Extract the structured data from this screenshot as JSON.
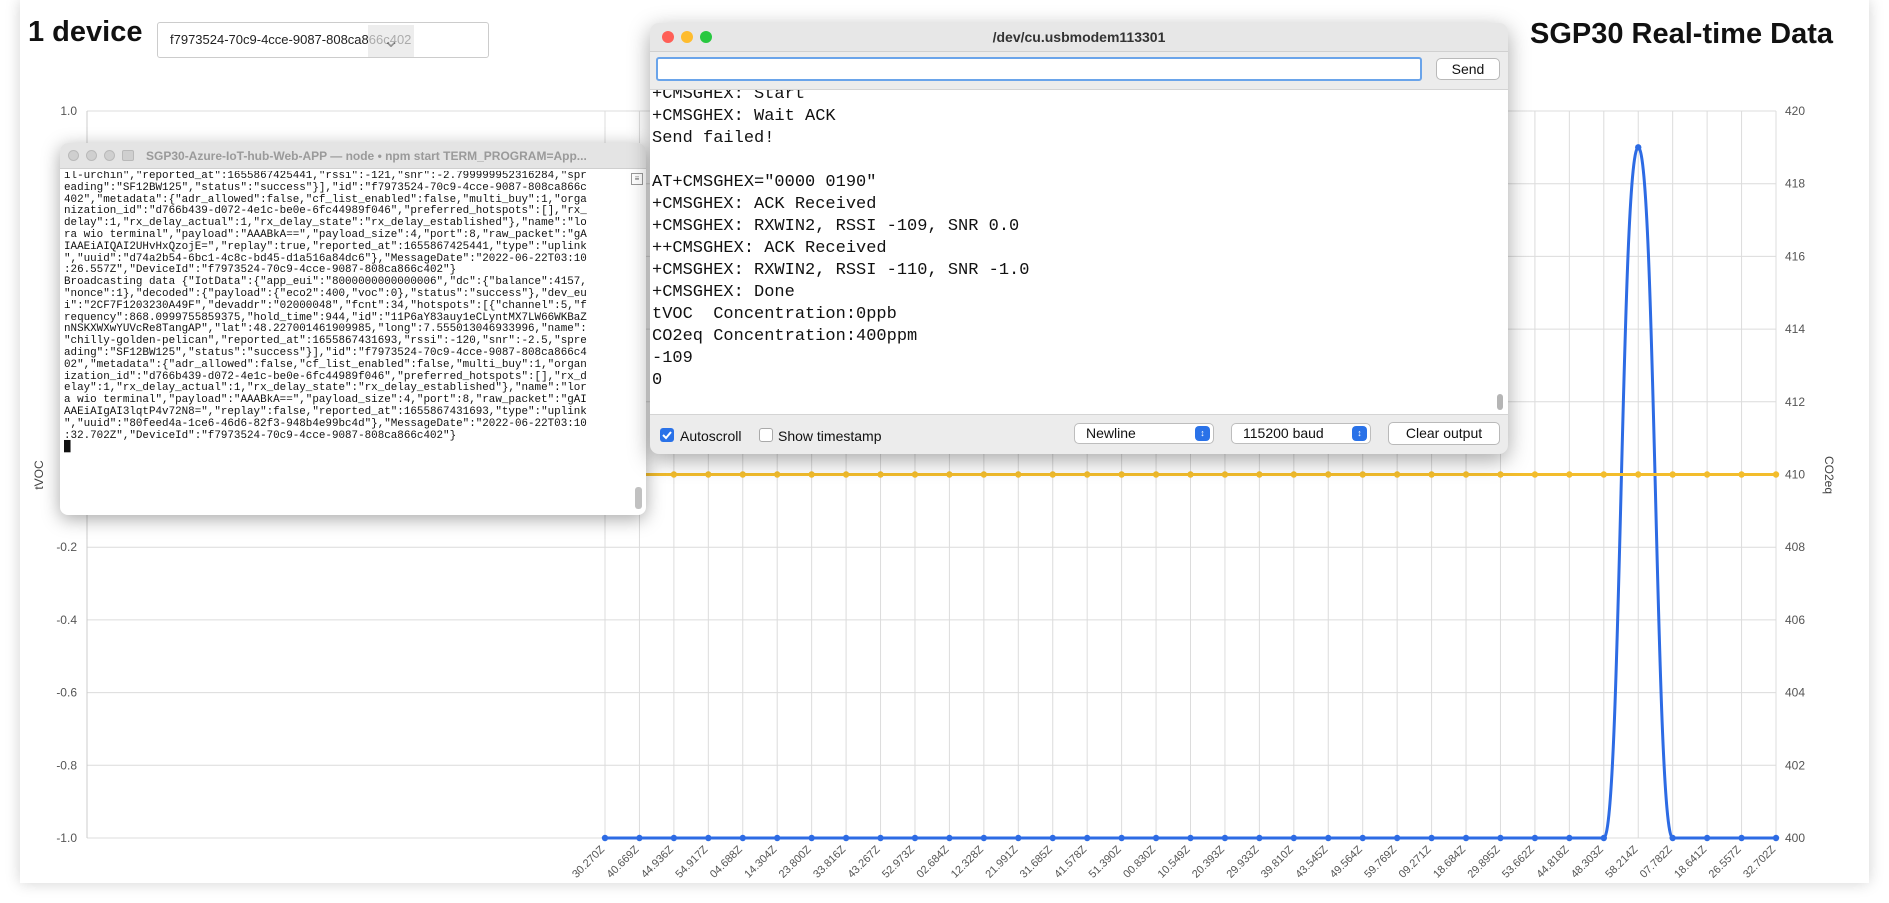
{
  "header": {
    "device_count": "1 device",
    "selected_device": "f7973524-70c9-4cce-9087-808ca866c402",
    "page_title": "SGP30 Real-time Data"
  },
  "colors": {
    "tvoc_series": "#2d6be4",
    "co2_series": "#f3bd2c",
    "grid": "#dcdcdc",
    "serial_input_border": "#6aa4ea"
  },
  "chart_data": {
    "type": "line",
    "ylabel": "tVOC",
    "y2label": "CO2eq",
    "ylim": [
      -1.0,
      1.0
    ],
    "y2lim": [
      400,
      420
    ],
    "yticks": [
      "1.0",
      "0.8",
      "0.6",
      "0.4",
      "0.2",
      "0.0",
      "-0.2",
      "-0.4",
      "-0.6",
      "-0.8",
      "-1.0"
    ],
    "y2ticks": [
      "420",
      "418",
      "416",
      "414",
      "412",
      "410",
      "408",
      "406",
      "404",
      "402",
      "400"
    ],
    "x": [
      "30.270Z",
      "40.669Z",
      "44.936Z",
      "54.917Z",
      "04.688Z",
      "14.304Z",
      "23.800Z",
      "33.816Z",
      "43.267Z",
      "52.973Z",
      "02.684Z",
      "12.328Z",
      "21.991Z",
      "31.685Z",
      "41.578Z",
      "51.390Z",
      "00.830Z",
      "10.549Z",
      "20.393Z",
      "29.933Z",
      "39.810Z",
      "43.545Z",
      "49.564Z",
      "59.769Z",
      "09.271Z",
      "18.684Z",
      "29.895Z",
      "53.662Z",
      "44.818Z",
      "48.303Z",
      "58.214Z",
      "07.782Z",
      "18.641Z",
      "26.557Z",
      "32.702Z"
    ],
    "series": [
      {
        "axis": "left",
        "color": "#2d6be4",
        "values": [
          0,
          0,
          0,
          0,
          0,
          0,
          0,
          0,
          0,
          0,
          0,
          0,
          0,
          0,
          0,
          0,
          0,
          0,
          0,
          0,
          0,
          0,
          0,
          0,
          0,
          0,
          0,
          0,
          0,
          0,
          419,
          0,
          0,
          0,
          0
        ]
      },
      {
        "axis": "right",
        "color": "#f3bd2c",
        "values": [
          410,
          410,
          410,
          410,
          410,
          410,
          410,
          410,
          410,
          410,
          410,
          410,
          410,
          410,
          410,
          410,
          410,
          410,
          410,
          410,
          410,
          410,
          410,
          410,
          410,
          410,
          410,
          410,
          410,
          410,
          410,
          410,
          410,
          410,
          410
        ]
      }
    ]
  },
  "terminal": {
    "title": "SGP30-Azure-IoT-hub-Web-APP — node • npm start TERM_PROGRAM=App...",
    "lines": [
      "il-urchin\",\"reported_at\":1655867425441,\"rssi\":-121,\"snr\":-2.799999952316284,\"spr",
      "eading\":\"SF12BW125\",\"status\":\"success\"}],\"id\":\"f7973524-70c9-4cce-9087-808ca866c",
      "402\",\"metadata\":{\"adr_allowed\":false,\"cf_list_enabled\":false,\"multi_buy\":1,\"orga",
      "nization_id\":\"d766b439-d072-4e1c-be0e-6fc44989f046\",\"preferred_hotspots\":[],\"rx_",
      "delay\":1,\"rx_delay_actual\":1,\"rx_delay_state\":\"rx_delay_established\"},\"name\":\"lo",
      "ra wio terminal\",\"payload\":\"AAABkA==\",\"payload_size\":4,\"port\":8,\"raw_packet\":\"gA",
      "IAAEiAIQAI2UHvHxQzojE=\",\"replay\":true,\"reported_at\":1655867425441,\"type\":\"uplink",
      "\",\"uuid\":\"d74a2b54-6bc1-4c8c-bd45-d1a516a84dc6\"},\"MessageDate\":\"2022-06-22T03:10",
      ":26.557Z\",\"DeviceId\":\"f7973524-70c9-4cce-9087-808ca866c402\"}",
      "Broadcasting data {\"IotData\":{\"app_eui\":\"8000000000000006\",\"dc\":{\"balance\":4157,",
      "\"nonce\":1},\"decoded\":{\"payload\":{\"eco2\":400,\"voc\":0},\"status\":\"success\"},\"dev_eu",
      "i\":\"2CF7F1203230A49F\",\"devaddr\":\"02000048\",\"fcnt\":34,\"hotspots\":[{\"channel\":5,\"f",
      "requency\":868.0999755859375,\"hold_time\":944,\"id\":\"11P6aY83auy1eCLyntMX7LW66WKBaZ",
      "nNSKXWXwYUVcRe8TangAP\",\"lat\":48.227001461909985,\"long\":7.555013046933996,\"name\":",
      "\"chilly-golden-pelican\",\"reported_at\":1655867431693,\"rssi\":-120,\"snr\":-2.5,\"spre",
      "ading\":\"SF12BW125\",\"status\":\"success\"}],\"id\":\"f7973524-70c9-4cce-9087-808ca866c4",
      "02\",\"metadata\":{\"adr_allowed\":false,\"cf_list_enabled\":false,\"multi_buy\":1,\"organ",
      "ization_id\":\"d766b439-d072-4e1c-be0e-6fc44989f046\",\"preferred_hotspots\":[],\"rx_d",
      "elay\":1,\"rx_delay_actual\":1,\"rx_delay_state\":\"rx_delay_established\"},\"name\":\"lor",
      "a wio terminal\",\"payload\":\"AAABkA==\",\"payload_size\":4,\"port\":8,\"raw_packet\":\"gAI",
      "AAEiAIgAI3lqtP4v72N8=\",\"replay\":false,\"reported_at\":1655867431693,\"type\":\"uplink",
      "\",\"uuid\":\"80feed4a-1ce6-46d6-82f3-948b4e99bc4d\"},\"MessageDate\":\"2022-06-22T03:10",
      ":32.702Z\",\"DeviceId\":\"f7973524-70c9-4cce-9087-808ca866c402\"}",
      "█"
    ]
  },
  "serial": {
    "title": "/dev/cu.usbmodem113301",
    "input_value": "",
    "send_label": "Send",
    "lines": [
      "+CMSGHEX: Start",
      "+CMSGHEX: Wait ACK",
      "Send failed!",
      "",
      "AT+CMSGHEX=\"0000 0190\"",
      "+CMSGHEX: ACK Received",
      "+CMSGHEX: RXWIN2, RSSI -109, SNR 0.0",
      "++CMSGHEX: ACK Received",
      "+CMSGHEX: RXWIN2, RSSI -110, SNR -1.0",
      "+CMSGHEX: Done",
      "tVOC  Concentration:0ppb",
      "CO2eq Concentration:400ppm",
      "-109",
      "0"
    ],
    "autoscroll_label": "Autoscroll",
    "autoscroll_checked": true,
    "timestamp_label": "Show timestamp",
    "timestamp_checked": false,
    "line_ending": "Newline",
    "baud_rate": "115200 baud",
    "clear_label": "Clear output"
  }
}
